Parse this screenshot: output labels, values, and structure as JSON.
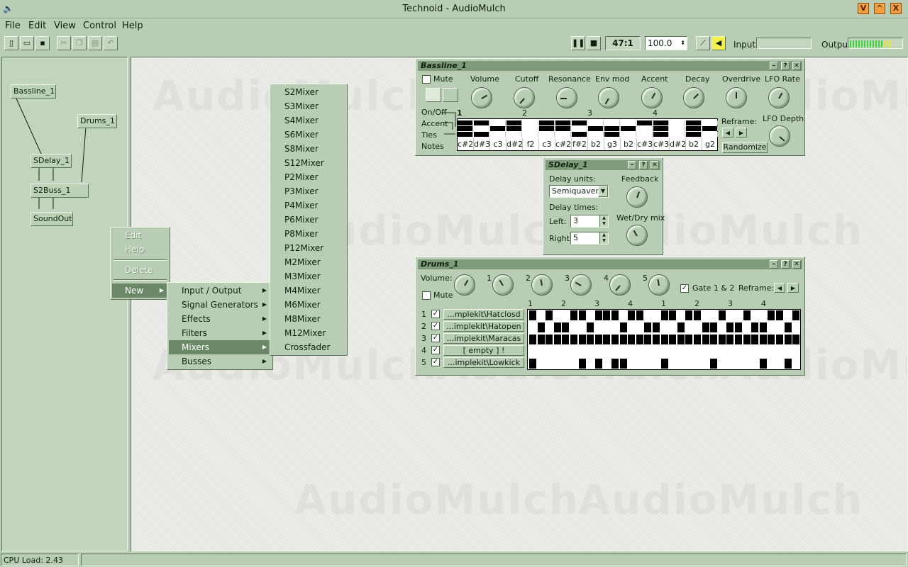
{
  "window": {
    "title": "Technoid - AudioMulch",
    "controls": [
      "V",
      "^",
      "X"
    ]
  },
  "menubar": [
    "File",
    "Edit",
    "View",
    "Control",
    "Help"
  ],
  "toolbar": {
    "position": "47:1",
    "tempo": "100.0",
    "input_label": "Input:",
    "output_label": "Output:"
  },
  "patch": {
    "nodes": [
      "Bassline_1",
      "Drums_1",
      "SDelay_1",
      "S2Buss_1",
      "SoundOut"
    ]
  },
  "watermark": "AudioMulch",
  "context_menu": {
    "items": [
      "Edit",
      "Help",
      "Delete",
      "New"
    ]
  },
  "new_submenu": {
    "items": [
      "Input / Output",
      "Signal Generators",
      "Effects",
      "Filters",
      "Mixers",
      "Busses"
    ]
  },
  "mixers_submenu": {
    "items": [
      "S2Mixer",
      "S3Mixer",
      "S4Mixer",
      "S6Mixer",
      "S8Mixer",
      "S12Mixer",
      "P2Mixer",
      "P3Mixer",
      "P4Mixer",
      "P6Mixer",
      "P8Mixer",
      "P12Mixer",
      "M2Mixer",
      "M3Mixer",
      "M4Mixer",
      "M6Mixer",
      "M8Mixer",
      "M12Mixer",
      "Crossfader"
    ]
  },
  "bassline": {
    "title": "Bassline_1",
    "mute": "Mute",
    "knobs": [
      "Volume",
      "Cutoff",
      "Resonance",
      "Env mod",
      "Accent",
      "Decay",
      "Overdrive",
      "LFO Rate"
    ],
    "lfo_depth": "LFO Depth",
    "reframe": "Reframe:",
    "randomize": "Randomize",
    "row_labels": [
      "On/Off",
      "Accent",
      "Ties",
      "Notes"
    ],
    "beats": [
      "1",
      "2",
      "3",
      "4"
    ],
    "notes": [
      "c#2",
      "d#3",
      "c3",
      "d#2",
      "f2",
      "c3",
      "c#2",
      "f#2",
      "b2",
      "g3",
      "b2",
      "c#3",
      "c#3",
      "d#2",
      "b2",
      "g2"
    ],
    "onoff": [
      1,
      1,
      0,
      1,
      0,
      1,
      1,
      1,
      0,
      0,
      0,
      1,
      1,
      0,
      1,
      0
    ],
    "accent": [
      1,
      0,
      1,
      1,
      0,
      1,
      1,
      0,
      1,
      1,
      1,
      0,
      1,
      0,
      1,
      1
    ],
    "ties": [
      1,
      1,
      0,
      0,
      0,
      0,
      0,
      1,
      0,
      1,
      0,
      0,
      1,
      0,
      1,
      0
    ]
  },
  "sdelay": {
    "title": "SDelay_1",
    "delay_units_label": "Delay units:",
    "delay_units": "Semiquavers",
    "delay_times_label": "Delay times:",
    "left_label": "Left:",
    "left_value": "3",
    "right_label": "Right:",
    "right_value": "5",
    "feedback": "Feedback",
    "wetdry": "Wet/Dry mix"
  },
  "drums": {
    "title": "Drums_1",
    "volume": "Volume:",
    "mute": "Mute",
    "channel_knobs": [
      "1",
      "2",
      "3",
      "4",
      "5"
    ],
    "gate": "Gate 1 & 2",
    "reframe": "Reframe:",
    "beats": [
      "1",
      "2",
      "3",
      "4",
      "1",
      "2",
      "3",
      "4"
    ],
    "tracks": [
      {
        "num": "1",
        "name": "...mplekit\\Hatclosd",
        "steps": [
          1,
          0,
          1,
          0,
          0,
          1,
          1,
          0,
          1,
          1,
          1,
          0,
          1,
          1,
          0,
          0,
          1,
          1,
          0,
          1,
          1,
          0,
          0,
          1,
          0,
          0,
          1,
          0,
          0,
          1,
          1,
          0,
          1
        ]
      },
      {
        "num": "2",
        "name": "...implekit\\Hatopen",
        "steps": [
          0,
          1,
          0,
          1,
          1,
          0,
          0,
          1,
          0,
          0,
          0,
          1,
          0,
          0,
          1,
          1,
          0,
          0,
          1,
          0,
          0,
          1,
          1,
          0,
          1,
          1,
          0,
          1,
          1,
          0,
          0,
          1,
          0
        ]
      },
      {
        "num": "3",
        "name": "...implekit\\Maracas",
        "steps": [
          1,
          1,
          1,
          1,
          1,
          1,
          1,
          1,
          1,
          1,
          1,
          1,
          1,
          1,
          1,
          1,
          1,
          1,
          1,
          1,
          1,
          1,
          1,
          1,
          1,
          1,
          1,
          1,
          1,
          1,
          1,
          1,
          1
        ]
      },
      {
        "num": "4",
        "name": "[ empty ] !",
        "steps": [
          0,
          0,
          0,
          0,
          0,
          0,
          0,
          0,
          0,
          0,
          0,
          0,
          0,
          0,
          0,
          0,
          0,
          0,
          0,
          0,
          0,
          0,
          0,
          0,
          0,
          0,
          0,
          0,
          0,
          0,
          0,
          0,
          0
        ]
      },
      {
        "num": "5",
        "name": "...implekit\\Lowkick",
        "steps": [
          1,
          0,
          0,
          0,
          0,
          0,
          1,
          0,
          1,
          0,
          1,
          1,
          0,
          0,
          0,
          0,
          1,
          0,
          0,
          0,
          0,
          0,
          1,
          0,
          0,
          0,
          0,
          0,
          1,
          0,
          0,
          1,
          0
        ]
      }
    ]
  },
  "status": {
    "cpu": "CPU Load: 2.43"
  }
}
